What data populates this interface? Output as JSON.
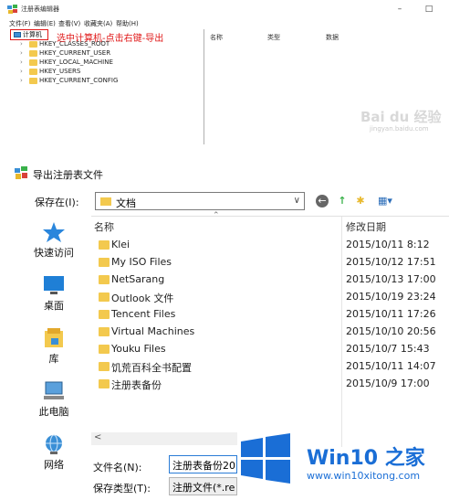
{
  "regedit": {
    "title": "注册表编辑器",
    "menu": [
      "文件(F)",
      "编辑(E)",
      "查看(V)",
      "收藏夹(A)",
      "帮助(H)"
    ],
    "computer_label": "计算机",
    "annotation": "选中计算机-点击右键-导出",
    "tree": [
      "HKEY_CLASSES_ROOT",
      "HKEY_CURRENT_USER",
      "HKEY_LOCAL_MACHINE",
      "HKEY_USERS",
      "HKEY_CURRENT_CONFIG"
    ],
    "columns": [
      "名称",
      "类型",
      "数据"
    ],
    "watermark": "Bai du 经验",
    "watermark_sub": "jingyan.baidu.com"
  },
  "dialog": {
    "title": "导出注册表文件",
    "savein_label": "保存在(I):",
    "savein_value": "文档",
    "places": [
      "快速访问",
      "桌面",
      "库",
      "此电脑",
      "网络"
    ],
    "columns": {
      "name": "名称",
      "modified": "修改日期"
    },
    "files": [
      {
        "name": "Klei",
        "date": "2015/10/11 8:12"
      },
      {
        "name": "My ISO Files",
        "date": "2015/10/12 17:51"
      },
      {
        "name": "NetSarang",
        "date": "2015/10/13 17:00"
      },
      {
        "name": "Outlook 文件",
        "date": "2015/10/19 23:24"
      },
      {
        "name": "Tencent Files",
        "date": "2015/10/11 17:26"
      },
      {
        "name": "Virtual Machines",
        "date": "2015/10/10 20:56"
      },
      {
        "name": "Youku Files",
        "date": "2015/10/7 15:43"
      },
      {
        "name": "饥荒百科全书配置",
        "date": "2015/10/11 14:07"
      },
      {
        "name": "注册表备份",
        "date": "2015/10/9 17:00"
      }
    ],
    "filename_label": "文件名(N):",
    "filename_value": "注册表备份201",
    "filetype_label": "保存类型(T):",
    "filetype_value": "注册文件(*.re"
  },
  "watermark": {
    "brand": "Win10 之家",
    "url": "www.win10xitong.com"
  },
  "colors": {
    "annotation": "#e01818",
    "folder": "#f3c94e",
    "brand": "#1a6ed6"
  }
}
